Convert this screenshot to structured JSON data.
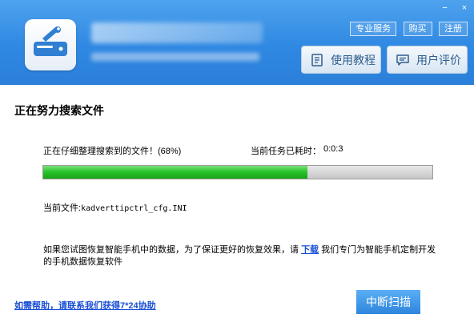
{
  "header": {
    "top_links": [
      "专业服务",
      "购买",
      "注册"
    ],
    "tutorial_button": "使用教程",
    "review_button": "用户评价",
    "window_controls": {
      "minimize": "−",
      "close": "×"
    },
    "icons": {
      "logo": "drive-wrench-logo",
      "tutorial": "book-icon",
      "review": "chat-icon"
    }
  },
  "content": {
    "heading": "正在努力搜索文件",
    "status_text": "正在仔细整理搜索到的文件！(68%)",
    "elapsed_label": "当前任务已耗时：",
    "elapsed_value": "0:0:3",
    "progress": 0.68,
    "current_file_label": "当前文件:",
    "current_file_name": "kadverttipctrl_cfg.INI",
    "note_before_link": "如果您试图恢复智能手机中的数据，为了保证更好的恢复效果，请",
    "note_link": "下载",
    "note_after_link": "我们专门为智能手机定制开发的手机数据恢复软件",
    "help_link": "如需帮助，请联系我们获得7*24协助",
    "stop_button": "中断扫描"
  },
  "colors": {
    "header_blue": "#2f88e2",
    "progress_green": "#2bc42b",
    "link_blue": "#1a4fd6"
  }
}
